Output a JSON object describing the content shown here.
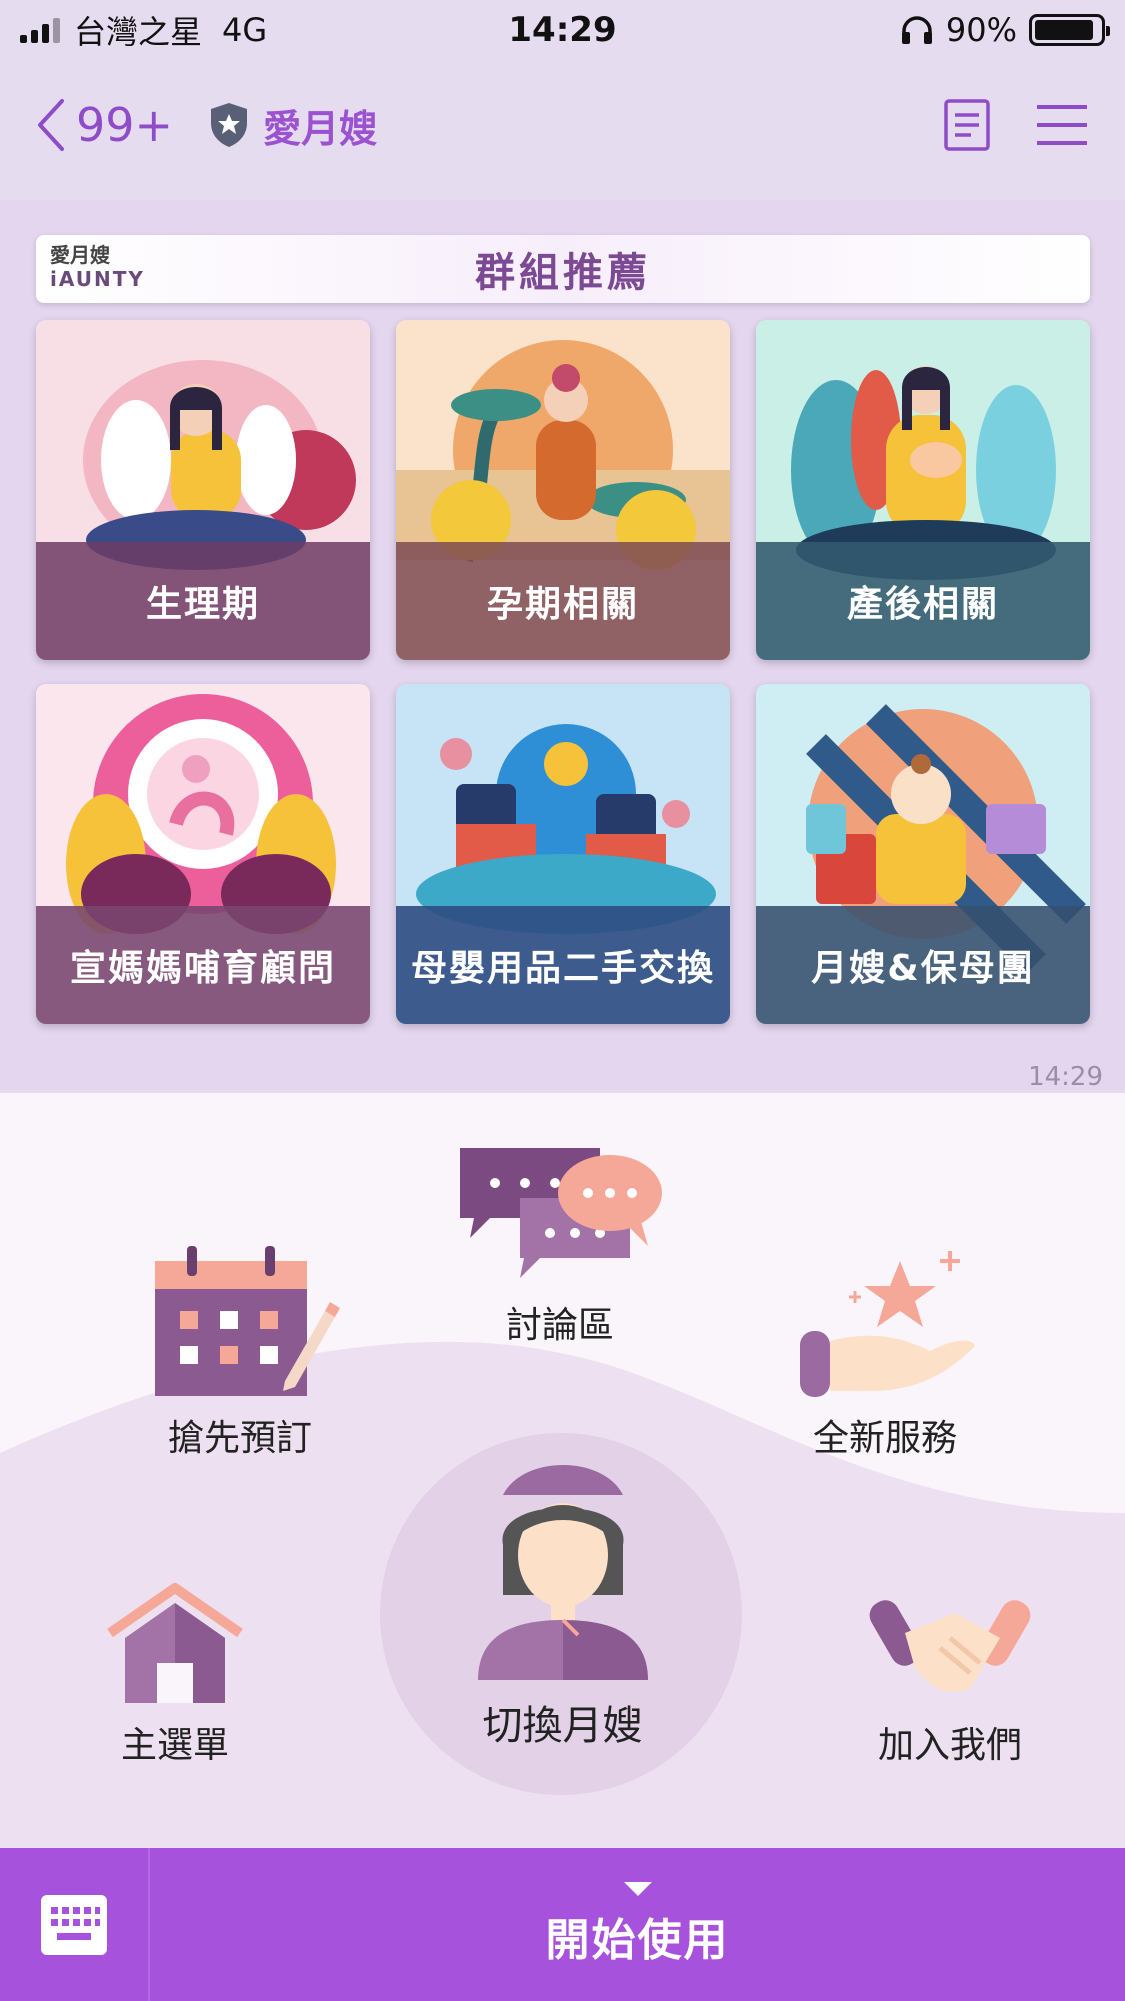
{
  "status_bar": {
    "carrier": "台灣之星",
    "network": "4G",
    "time": "14:29",
    "battery": "90%",
    "battery_level": 0.9
  },
  "nav": {
    "unread_count": "99+",
    "chat_name": "愛月嫂"
  },
  "banner": {
    "brand_cn": "愛月嫂",
    "brand_en": "iAUNTY",
    "title": "群組推薦"
  },
  "groups": [
    {
      "label": "生理期"
    },
    {
      "label": "孕期相關"
    },
    {
      "label": "產後相關"
    },
    {
      "label": "宣媽媽哺育顧問"
    },
    {
      "label": "母嬰用品二手交換"
    },
    {
      "label": "月嫂&保母團"
    }
  ],
  "message_time": "14:29",
  "menu": {
    "discussion": "討論區",
    "reserve": "搶先預訂",
    "new_service": "全新服務",
    "main_menu": "主選單",
    "switch_aunty": "切換月嫂",
    "join_us": "加入我們"
  },
  "bottom_bar": {
    "start_label": "開始使用"
  },
  "colors": {
    "accent": "#a752dd",
    "nav_purple": "#8e4cc9",
    "chat_bg": "#e3d6ee",
    "menu_bg": "#faf4fb"
  }
}
